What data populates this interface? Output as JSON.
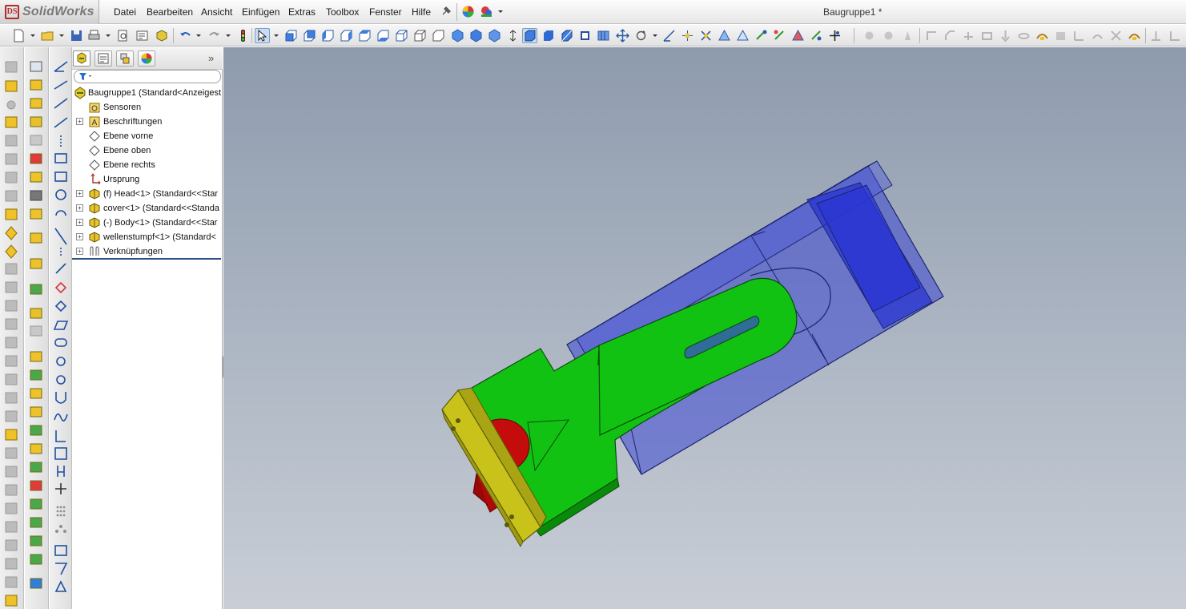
{
  "app": {
    "name": "SolidWorks",
    "logo_mark": "DS"
  },
  "menubar": {
    "items": [
      "Datei",
      "Bearbeiten",
      "Ansicht",
      "Einfügen",
      "Extras",
      "Toolbox",
      "Fenster",
      "Hilfe"
    ],
    "document_title": "Baugruppe1 *"
  },
  "feature_manager": {
    "tabs": [
      "feature-manager-tab",
      "property-manager-tab",
      "configuration-manager-tab",
      "display-manager-tab"
    ],
    "nodes": [
      {
        "label": "Baugruppe1  (Standard<Anzeigest",
        "icon": "assembly-icon"
      },
      {
        "label": "Sensoren",
        "icon": "sensor-folder-icon"
      },
      {
        "label": "Beschriftungen",
        "icon": "annotations-icon"
      },
      {
        "label": "Ebene vorne",
        "icon": "plane-icon"
      },
      {
        "label": "Ebene oben",
        "icon": "plane-icon"
      },
      {
        "label": "Ebene rechts",
        "icon": "plane-icon"
      },
      {
        "label": "Ursprung",
        "icon": "origin-icon"
      },
      {
        "label": "(f) Head<1> (Standard<<Star",
        "icon": "part-icon"
      },
      {
        "label": "cover<1> (Standard<<Standa",
        "icon": "part-icon"
      },
      {
        "label": "(-) Body<1> (Standard<<Star",
        "icon": "part-icon"
      },
      {
        "label": "wellenstumpf<1> (Standard<",
        "icon": "part-icon"
      },
      {
        "label": "Verknüpfungen",
        "icon": "mates-icon"
      }
    ]
  },
  "colors": {
    "body_transparent_blue": "#3c47d2",
    "slider_green": "#12c212",
    "head_yellow": "#c8c21a",
    "shaft_red": "#c40c0c",
    "viewport_top": "#8e9bad",
    "viewport_bottom": "#c9ced6"
  }
}
